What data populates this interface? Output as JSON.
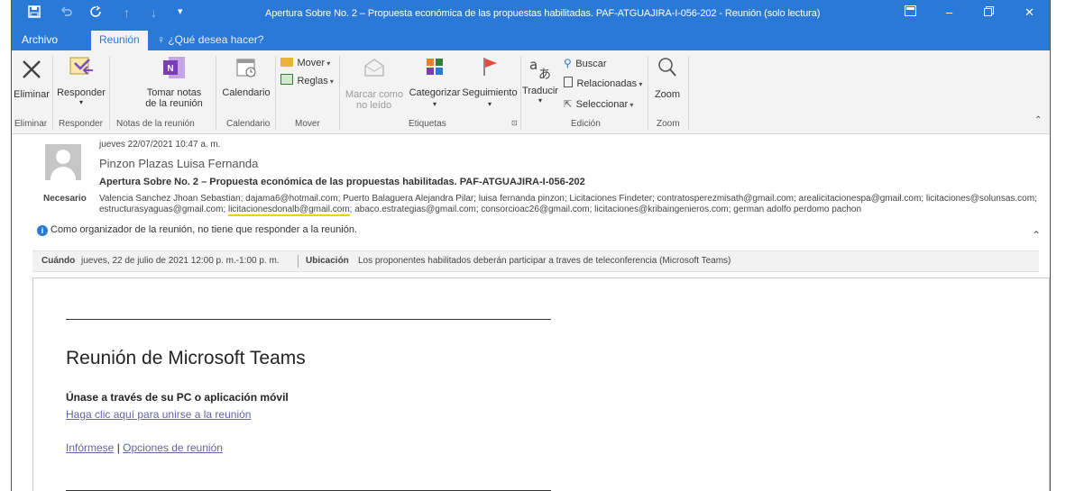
{
  "title_bar": {
    "title": "Apertura Sobre No. 2 – Propuesta económica de las  propuestas habilitadas. PAF-ATGUAJIRA-I-056-202 - Reunión  (solo lectura)",
    "save_icon": "save-icon",
    "undo_icon": "undo-icon",
    "redo_icon": "redo-icon"
  },
  "tabs": {
    "archivo": "Archivo",
    "reunion": "Reunión",
    "tell_me": "¿Qué desea hacer?"
  },
  "ribbon": {
    "eliminar": "Eliminar",
    "responder": "Responder",
    "tomar_notas_1": "Tomar notas",
    "tomar_notas_2": "de la reunión",
    "calendario": "Calendario",
    "mover": "Mover",
    "reglas": "Reglas",
    "marcar_1": "Marcar como",
    "marcar_2": "no leído",
    "categorizar": "Categorizar",
    "seguimiento": "Seguimiento",
    "traducir": "Traducir",
    "buscar": "Buscar",
    "relacionadas": "Relacionadas",
    "seleccionar": "Seleccionar",
    "zoom": "Zoom",
    "groups": {
      "eliminar": "Eliminar",
      "responder": "Responder",
      "notas": "Notas de la reunión",
      "calendario": "Calendario",
      "mover": "Mover",
      "etiquetas": "Etiquetas",
      "edicion": "Edición",
      "zoom": "Zoom"
    }
  },
  "header": {
    "date": "jueves 22/07/2021 10:47 a. m.",
    "sender": "Pinzon Plazas Luisa Fernanda",
    "subject": "Apertura Sobre No. 2 – Propuesta económica de las  propuestas habilitadas. PAF-ATGUAJIRA-I-056-202",
    "required_label": "Necesario",
    "required_part1": "Valencia Sanchez Jhoan Sebastian; dajama6@hotmail.com; Puerto Balaguera Alejandra Pilar; luisa fernanda pinzon; Licitaciones Findeter; contratosperezmisath@gmail.com; arealicitacionespa@gmail.com; licitaciones@solunsas.com; estructurasyaguas@gmail.com; ",
    "required_highlight": "licitacionesdonalb@gmail.com",
    "required_part2": "; abaco.estrategias@gmail.com; consorcioac26@gmail.com; licitaciones@kribaingenieros.com; german adolfo perdomo pachon",
    "info": "Como organizador de la reunión, no tiene que responder a la reunión."
  },
  "when_bar": {
    "when_label": "Cuándo",
    "when_value": "jueves, 22 de julio de 2021 12:00 p. m.-1:00 p. m.",
    "location_label": "Ubicación",
    "location_value": "Los proponentes habilitados deberán participar a traves de teleconferencia (Microsoft Teams)"
  },
  "body": {
    "teams_title": "Reunión de Microsoft Teams",
    "join_title": "Únase a través de su PC o aplicación móvil",
    "join_link": "Haga clic aquí para unirse a la reunión",
    "learn_more": "Infórmese",
    "separator": "|",
    "meeting_options": "Opciones de reunión"
  },
  "colors": {
    "accent": "#2b79d6",
    "teams_link": "#6264a7",
    "highlight": "#f0d400"
  }
}
